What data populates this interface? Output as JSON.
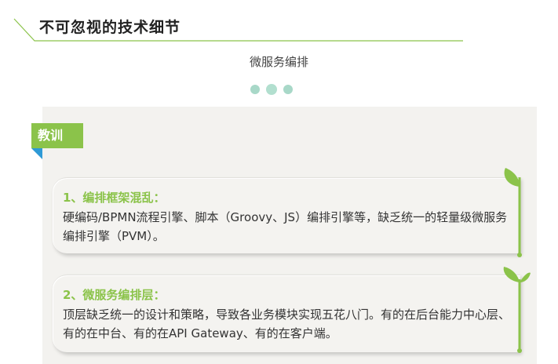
{
  "header": {
    "title": "不可忽视的技术细节"
  },
  "subtitle": "微服务编排",
  "panel": {
    "tag": "教训",
    "cards": [
      {
        "heading": "1、编排框架混乱：",
        "text": "硬编码/BPMN流程引擎、脚本（Groovy、JS）编排引擎等，缺乏统一的轻量级微服务编排引擎（PVM）。"
      },
      {
        "heading": "2、微服务编排层：",
        "text": "顶层缺乏统一的设计和策略，导致各业务模块实现五花八门。有的在后台能力中心层、有的在中台、有的在API Gateway、有的在客户端。"
      }
    ]
  },
  "colors": {
    "accent": "#8bc34a",
    "fold": "#2e9ad6",
    "dots": "#a8d8c8",
    "panel": "#f3f2ef"
  },
  "icons": [
    "sprout-icon",
    "sprout-icon"
  ]
}
